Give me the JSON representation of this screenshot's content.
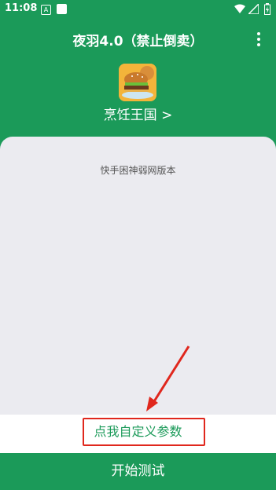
{
  "status_bar": {
    "time": "11:08",
    "notification_letter": "A"
  },
  "app_bar": {
    "title": "夜羽4.0（禁止倒卖）"
  },
  "game": {
    "name": "烹饪王国 >"
  },
  "card": {
    "version_text": "快手困神弱网版本"
  },
  "custom_params": {
    "label": "点我自定义参数"
  },
  "start_button": {
    "label": "开始测试"
  },
  "colors": {
    "primary": "#1b9a59",
    "highlight_border": "#e0271d",
    "card_bg": "#ebebf0"
  }
}
